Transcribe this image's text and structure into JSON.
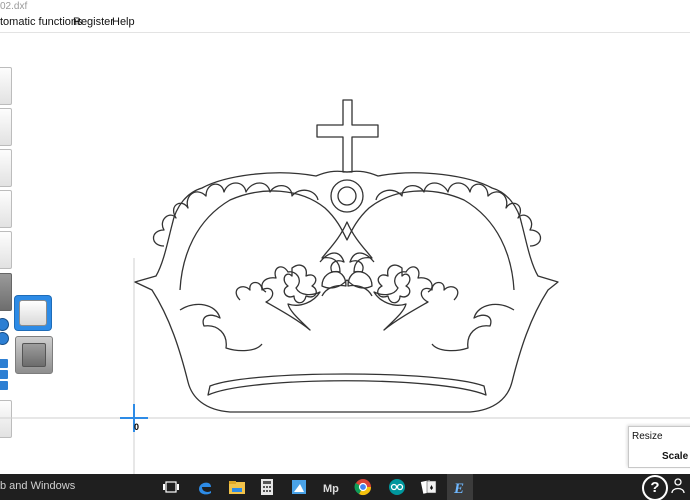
{
  "window": {
    "title": "02.dxf"
  },
  "menu": {
    "items": [
      "tomatic functions",
      "Register",
      "Help"
    ]
  },
  "canvas": {
    "origin_label": "0"
  },
  "resize_panel": {
    "title": "Resize",
    "scale_label": "Scale fa"
  },
  "taskbar": {
    "search_text": "b and Windows",
    "help_label": "?",
    "icons": [
      "task-view-icon",
      "edge-icon",
      "file-explorer-icon",
      "calculator-icon",
      "paint-icon",
      "media-player-icon",
      "chrome-icon",
      "arduino-icon",
      "solitaire-icon",
      "app-e-icon"
    ]
  },
  "colors": {
    "accent": "#2d8be6",
    "taskbar": "#1f1f1f",
    "outline": "#333333"
  }
}
